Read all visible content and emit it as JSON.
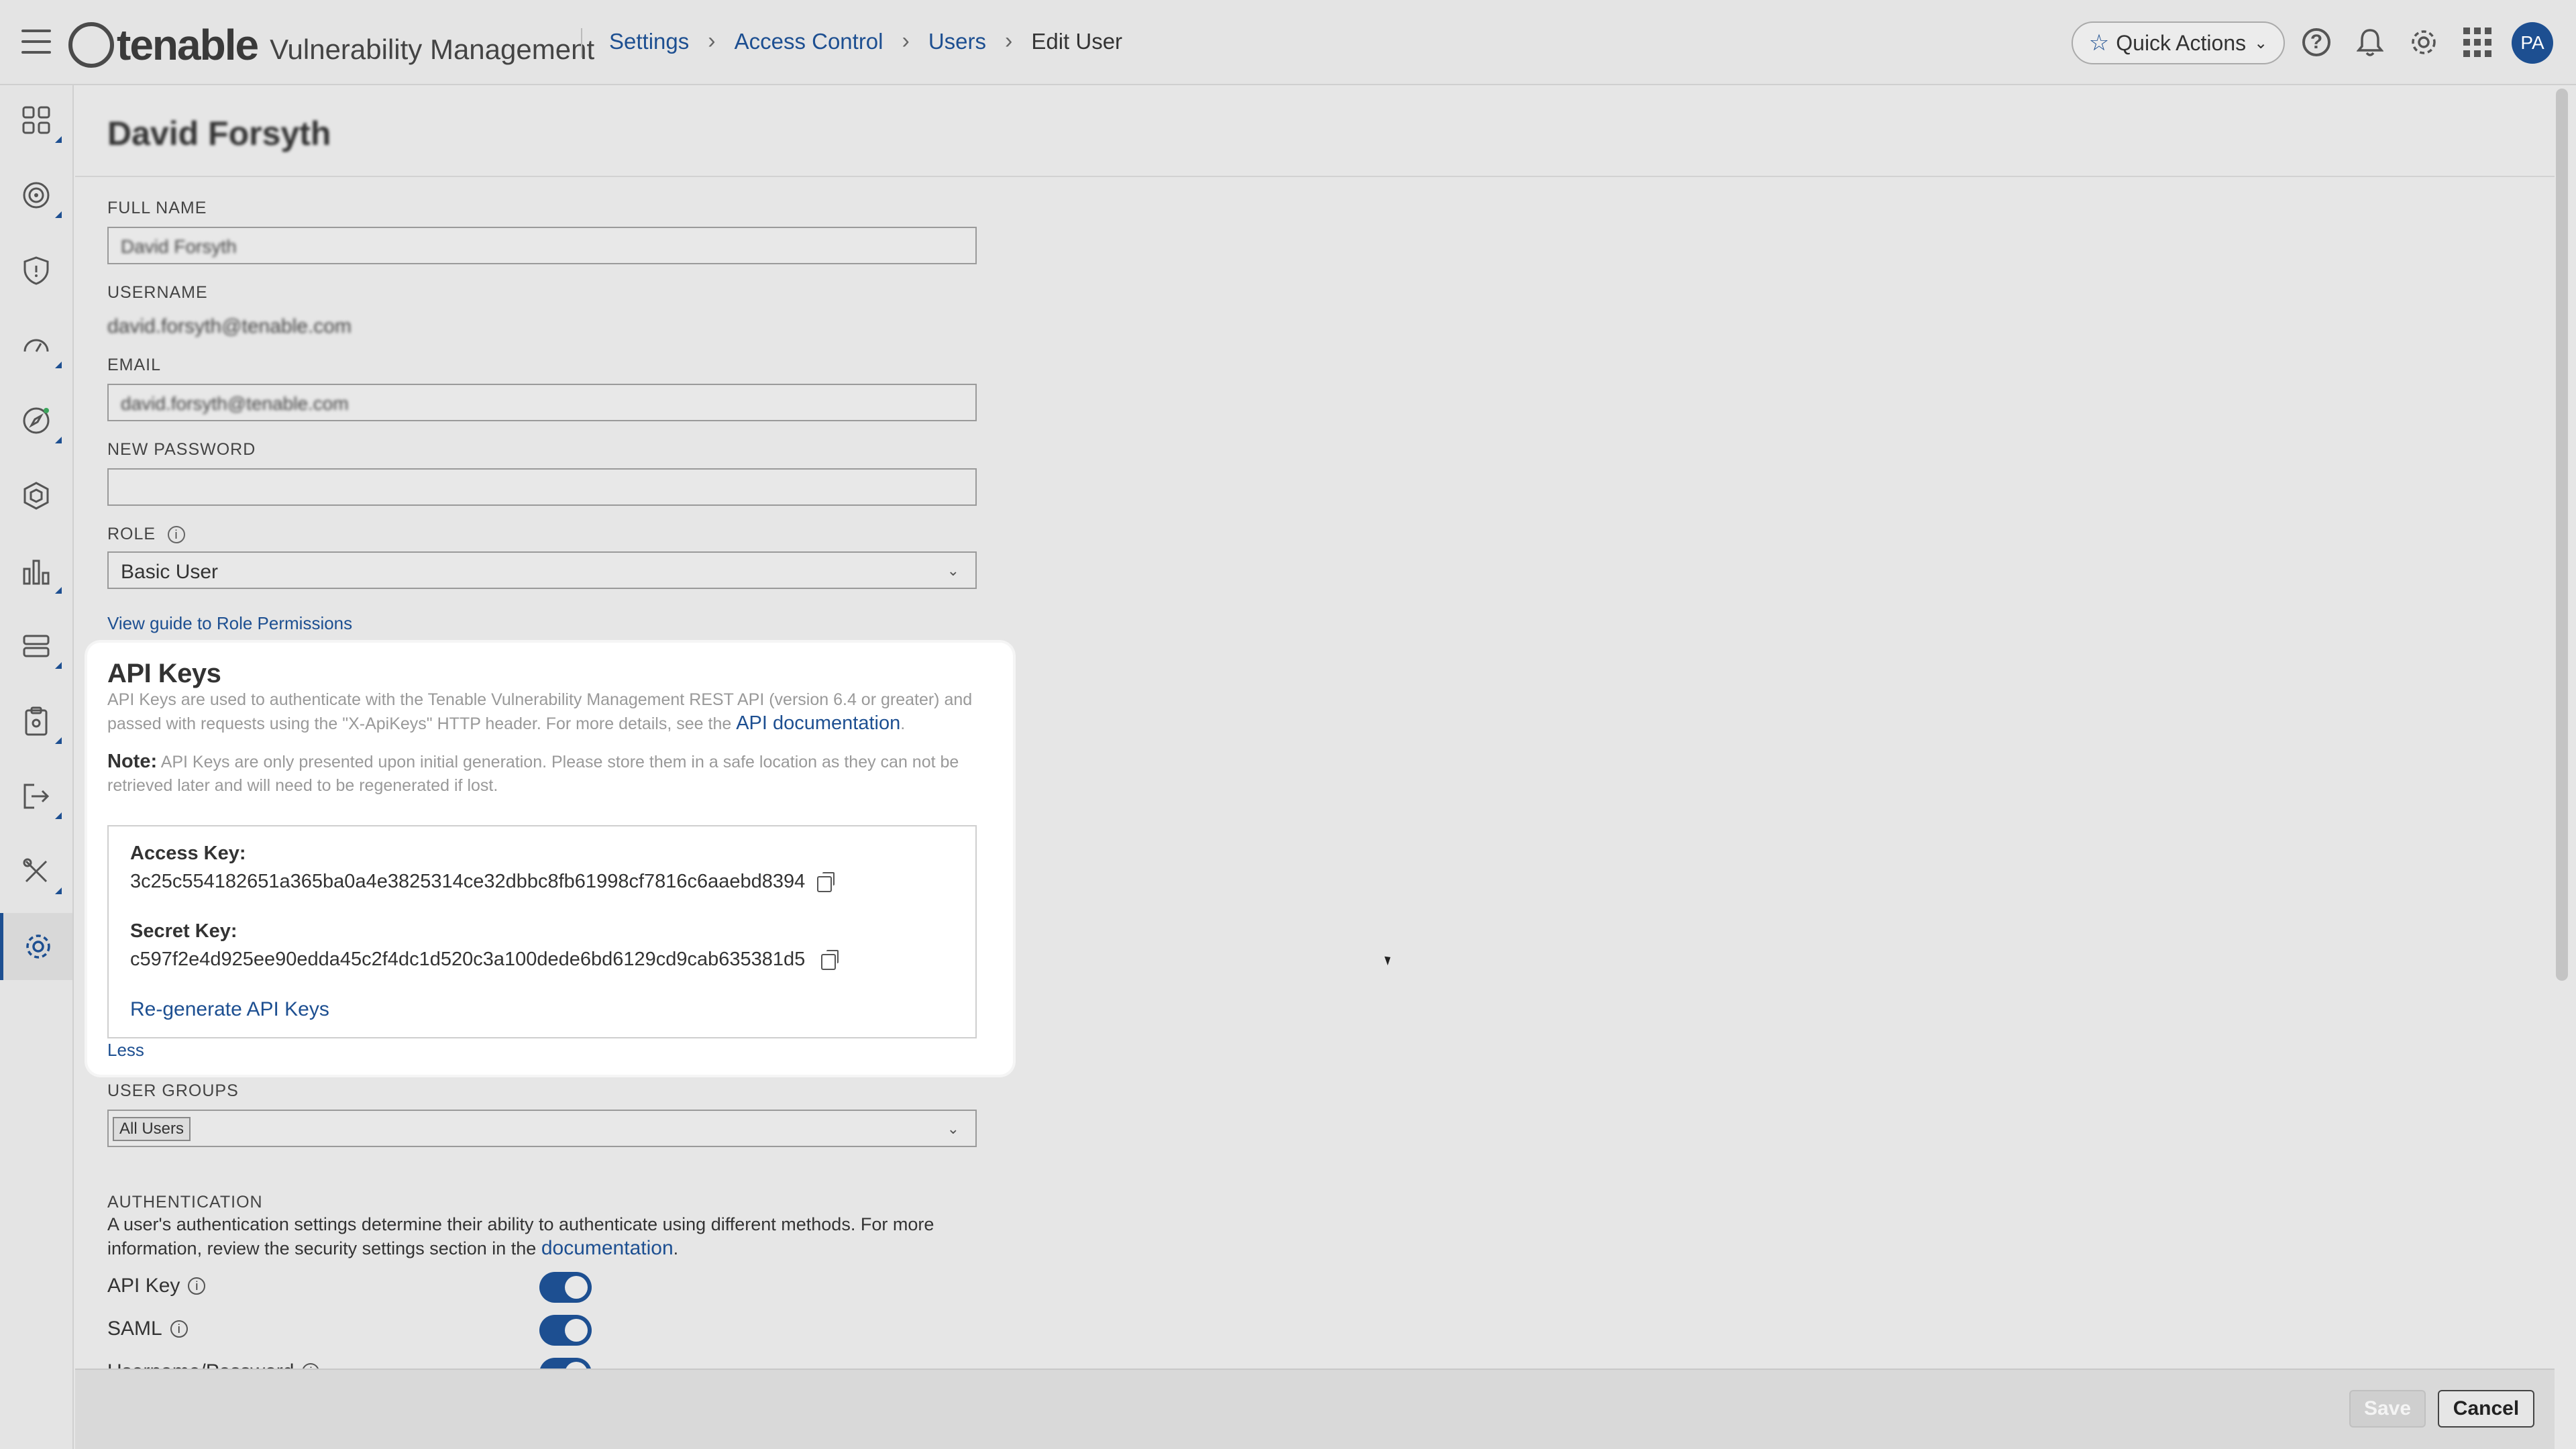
{
  "header": {
    "logo_text": "tenable",
    "product_name": "Vulnerability Management",
    "breadcrumb": [
      "Settings",
      "Access Control",
      "Users"
    ],
    "breadcrumb_current": "Edit User",
    "quick_actions_label": "Quick Actions",
    "avatar_initials": "PA",
    "icons": [
      "menu-icon",
      "star-icon",
      "help-icon",
      "bell-icon",
      "gear-icon",
      "apps-grid-icon"
    ]
  },
  "sidebar": {
    "items": [
      {
        "icon": "dashboard-grid-icon"
      },
      {
        "icon": "target-icon"
      },
      {
        "icon": "shield-icon"
      },
      {
        "icon": "gauge-icon"
      },
      {
        "icon": "compass-icon"
      },
      {
        "icon": "hexagon-icon"
      },
      {
        "icon": "bar-chart-icon"
      },
      {
        "icon": "server-stack-icon"
      },
      {
        "icon": "clipboard-icon"
      },
      {
        "icon": "export-icon"
      },
      {
        "icon": "tools-icon"
      },
      {
        "icon": "settings-gear-icon",
        "active": true
      }
    ],
    "accent_color": "#1d4f91"
  },
  "form": {
    "user_title": "David Forsyth",
    "full_name_label": "FULL NAME",
    "full_name_value": "David Forsyth",
    "username_label": "USERNAME",
    "username_value": "david.forsyth@tenable.com",
    "email_label": "EMAIL",
    "email_value": "david.forsyth@tenable.com",
    "new_password_label": "NEW PASSWORD",
    "new_password_value": "",
    "role_label": "ROLE",
    "role_value": "Basic User",
    "role_guide_link": "View guide to Role Permissions"
  },
  "api_keys": {
    "title": "API Keys",
    "description": "API Keys are used to authenticate with the Tenable Vulnerability Management REST API (version 6.4 or greater) and passed with requests using the \"X-ApiKeys\" HTTP header. For more details, see the",
    "doc_link": "API documentation",
    "note_label": "Note:",
    "note_text": "API Keys are only presented upon initial generation. Please store them in a safe location as they can not be retrieved later and will need to be regenerated if lost.",
    "access_key_label": "Access Key:",
    "access_key_value": "3c25c554182651a365ba0a4e3825314ce32dbbc8fb61998cf7816c6aaebd8394",
    "secret_key_label": "Secret Key:",
    "secret_key_value": "c597f2e4d925ee90edda45c2f4dc1d520c3a100dede6bd6129cd9cab635381d5",
    "regenerate_link": "Re-generate API Keys",
    "less_link": "Less"
  },
  "groups": {
    "label": "USER GROUPS",
    "selected_tag": "All Users"
  },
  "authentication": {
    "label": "AUTHENTICATION",
    "description": "A user's authentication settings determine their ability to authenticate using different methods. For more information, review the security settings section in the",
    "doc_link": "documentation",
    "options": [
      {
        "label": "API Key",
        "enabled": true
      },
      {
        "label": "SAML",
        "enabled": true
      },
      {
        "label": "Username/Password",
        "enabled": true
      }
    ]
  },
  "footer": {
    "save_label": "Save",
    "cancel_label": "Cancel"
  }
}
